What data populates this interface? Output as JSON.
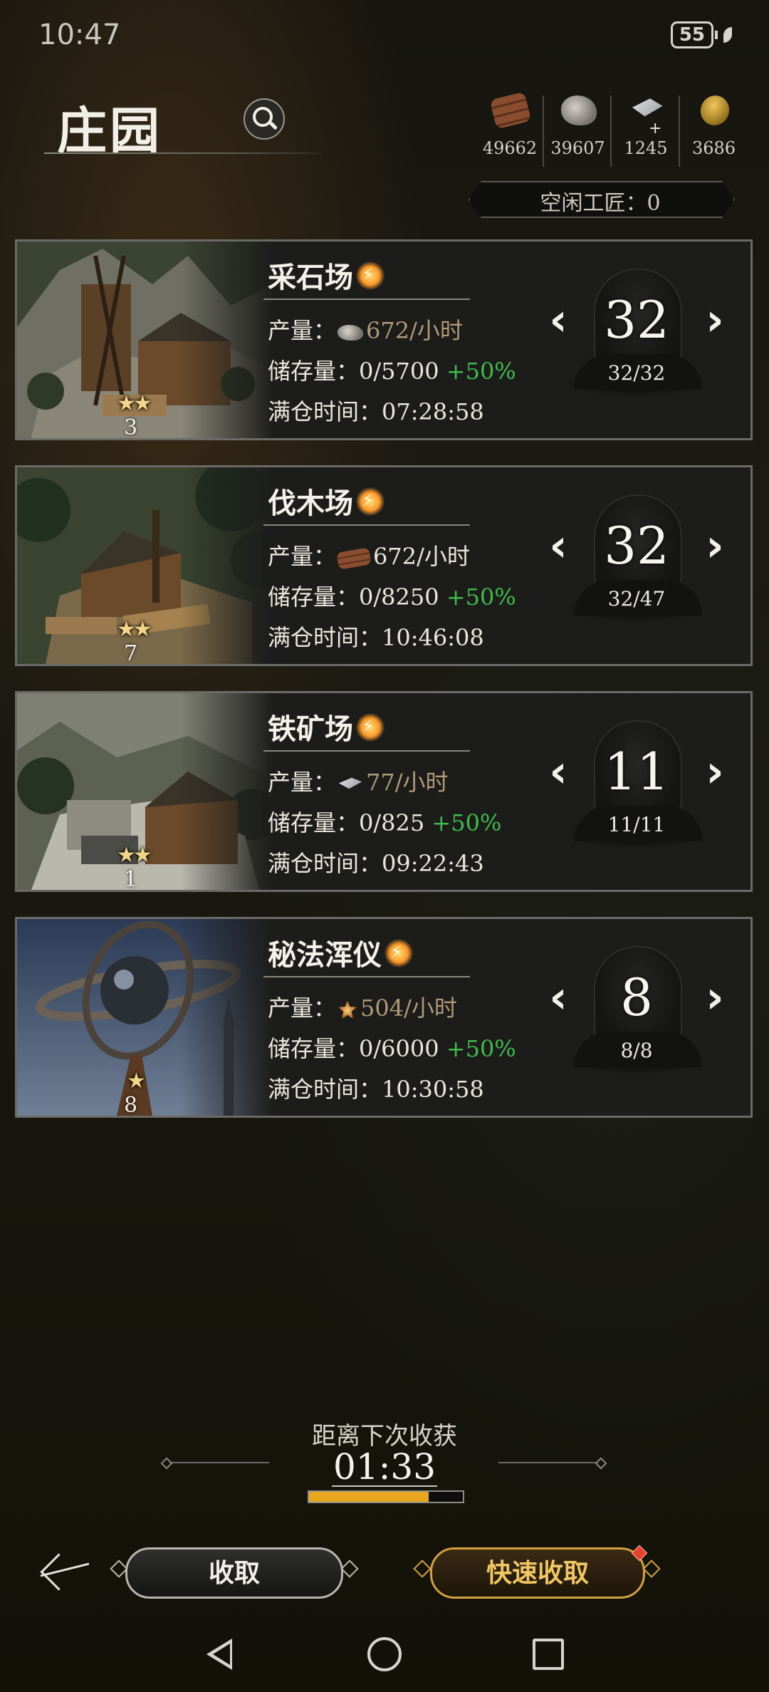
{
  "status_bar": {
    "time": "10:47",
    "battery": "55"
  },
  "header": {
    "title": "庄园"
  },
  "resources": [
    {
      "icon": "wood-icon",
      "value": "49662"
    },
    {
      "icon": "stone-icon",
      "value": "39607"
    },
    {
      "icon": "iron-icon",
      "value": "1245"
    },
    {
      "icon": "coin-icon",
      "value": "3686"
    }
  ],
  "idle_artisans": "空闲工匠：0",
  "buildings": [
    {
      "name": "采石场",
      "level": "3",
      "stars": "★★",
      "output_label": "产量：",
      "output_rate": "672/小时",
      "resource_icon": "stone-icon",
      "storage_label": "储存量：",
      "storage": "0/5700",
      "bonus": "+50%",
      "full_label": "满仓时间：",
      "full_time": "07:28:58",
      "workers": "32",
      "workers_ratio": "32/32"
    },
    {
      "name": "伐木场",
      "level": "7",
      "stars": "★★",
      "output_label": "产量：",
      "output_rate": "672/小时",
      "resource_icon": "wood-icon",
      "storage_label": "储存量：",
      "storage": "0/8250",
      "bonus": "+50%",
      "full_label": "满仓时间：",
      "full_time": "10:46:08",
      "workers": "32",
      "workers_ratio": "32/47"
    },
    {
      "name": "铁矿场",
      "level": "1",
      "stars": "★★",
      "output_label": "产量：",
      "output_rate": "77/小时",
      "resource_icon": "iron-icon",
      "storage_label": "储存量：",
      "storage": "0/825",
      "bonus": "+50%",
      "full_label": "满仓时间：",
      "full_time": "09:22:43",
      "workers": "11",
      "workers_ratio": "11/11"
    },
    {
      "name": "秘法浑仪",
      "level": "8",
      "stars": "★",
      "output_label": "产量：",
      "output_rate": "504/小时",
      "resource_icon": "arcane-icon",
      "storage_label": "储存量：",
      "storage": "0/6000",
      "bonus": "+50%",
      "full_label": "满仓时间：",
      "full_time": "10:30:58",
      "workers": "8",
      "workers_ratio": "8/8"
    }
  ],
  "harvest": {
    "label": "距离下次收获",
    "timer": "01:33",
    "progress": 0.78
  },
  "buttons": {
    "collect": "收取",
    "quick_collect": "快速收取"
  },
  "colors": {
    "bonus": "#3fbb4c",
    "accent": "#e7a820",
    "rate": "#b29a78"
  }
}
